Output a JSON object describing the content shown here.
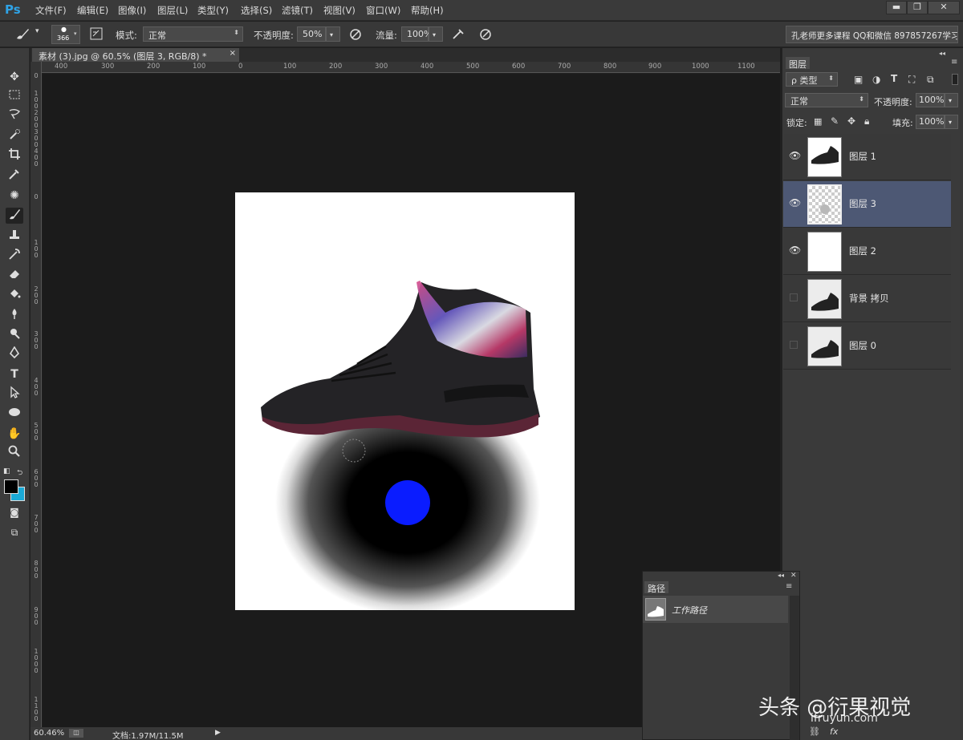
{
  "app": {
    "logo": "Ps"
  },
  "menu": [
    "文件(F)",
    "编辑(E)",
    "图像(I)",
    "图层(L)",
    "类型(Y)",
    "选择(S)",
    "滤镜(T)",
    "视图(V)",
    "窗口(W)",
    "帮助(H)"
  ],
  "window_controls": {
    "minimize": "▬",
    "restore": "❐",
    "close": "✕"
  },
  "options": {
    "brush_size": "366",
    "mode_label": "模式:",
    "mode_value": "正常",
    "opacity_label": "不透明度:",
    "opacity_value": "50%",
    "flow_label": "流量:",
    "flow_value": "100%"
  },
  "banner": "孔老师更多课程 QQ和微信 897857267学习",
  "document_tab": "素材 (3).jpg @ 60.5% (图层 3, RGB/8) *",
  "ruler_h_ticks": [
    "400",
    "300",
    "200",
    "100",
    "0",
    "100",
    "200",
    "300",
    "400",
    "500",
    "600",
    "700",
    "800",
    "900",
    "1000",
    "1100"
  ],
  "ruler_v_ticks": [
    "0",
    "1 0 0",
    "2 0 0",
    "3 0 0",
    "4 0 0",
    "0",
    "1 0 0",
    "2 0 0",
    "3 0 0",
    "4 0 0",
    "5 0 0",
    "6 0 0",
    "7 0 0",
    "8 0 0",
    "9 0 0",
    "1 0 0 0",
    "1 1 0 0"
  ],
  "status": {
    "zoom": "60.46%",
    "doc": "文档:1.97M/11.5M"
  },
  "layers_panel": {
    "tab": "图层",
    "filter": "ρ 类型",
    "blend": "正常",
    "opacity_label": "不透明度:",
    "opacity_value": "100%",
    "lock_label": "锁定:",
    "fill_label": "填充:",
    "fill_value": "100%",
    "layers": [
      {
        "name": "图层 1",
        "visible": true,
        "selected": false
      },
      {
        "name": "图层 3",
        "visible": true,
        "selected": true
      },
      {
        "name": "图层 2",
        "visible": true,
        "selected": false
      },
      {
        "name": "背景 拷贝",
        "visible": false,
        "selected": false
      },
      {
        "name": "图层 0",
        "visible": false,
        "selected": false
      }
    ]
  },
  "paths_panel": {
    "tab": "路径",
    "item": "工作路径"
  },
  "watermark": {
    "main": "头条 @衍果视觉",
    "sub": "ifruyun.com"
  },
  "colors": {
    "accent_blue": "#0a1cff",
    "selected_layer": "#4d5874",
    "foreground": "#000000",
    "background": "#1aa9d6"
  }
}
